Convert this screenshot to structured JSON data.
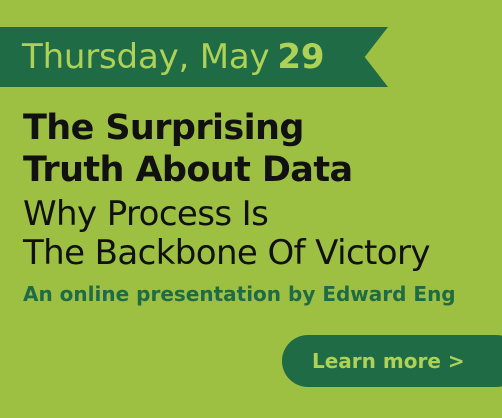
{
  "date_banner": {
    "day_text": "Thursday, May",
    "date_number": "29"
  },
  "headline": {
    "line1": "The Surprising",
    "line2": "Truth About Data"
  },
  "subtitle": {
    "line1": "Why Process Is",
    "line2": "The Backbone Of Victory"
  },
  "byline": "An online presentation by Edward Eng",
  "cta": {
    "label": "Learn more >"
  },
  "colors": {
    "background": "#9dc043",
    "dark_green": "#1f6b45",
    "light_green_text": "#aed256",
    "headline_text": "#111111"
  }
}
